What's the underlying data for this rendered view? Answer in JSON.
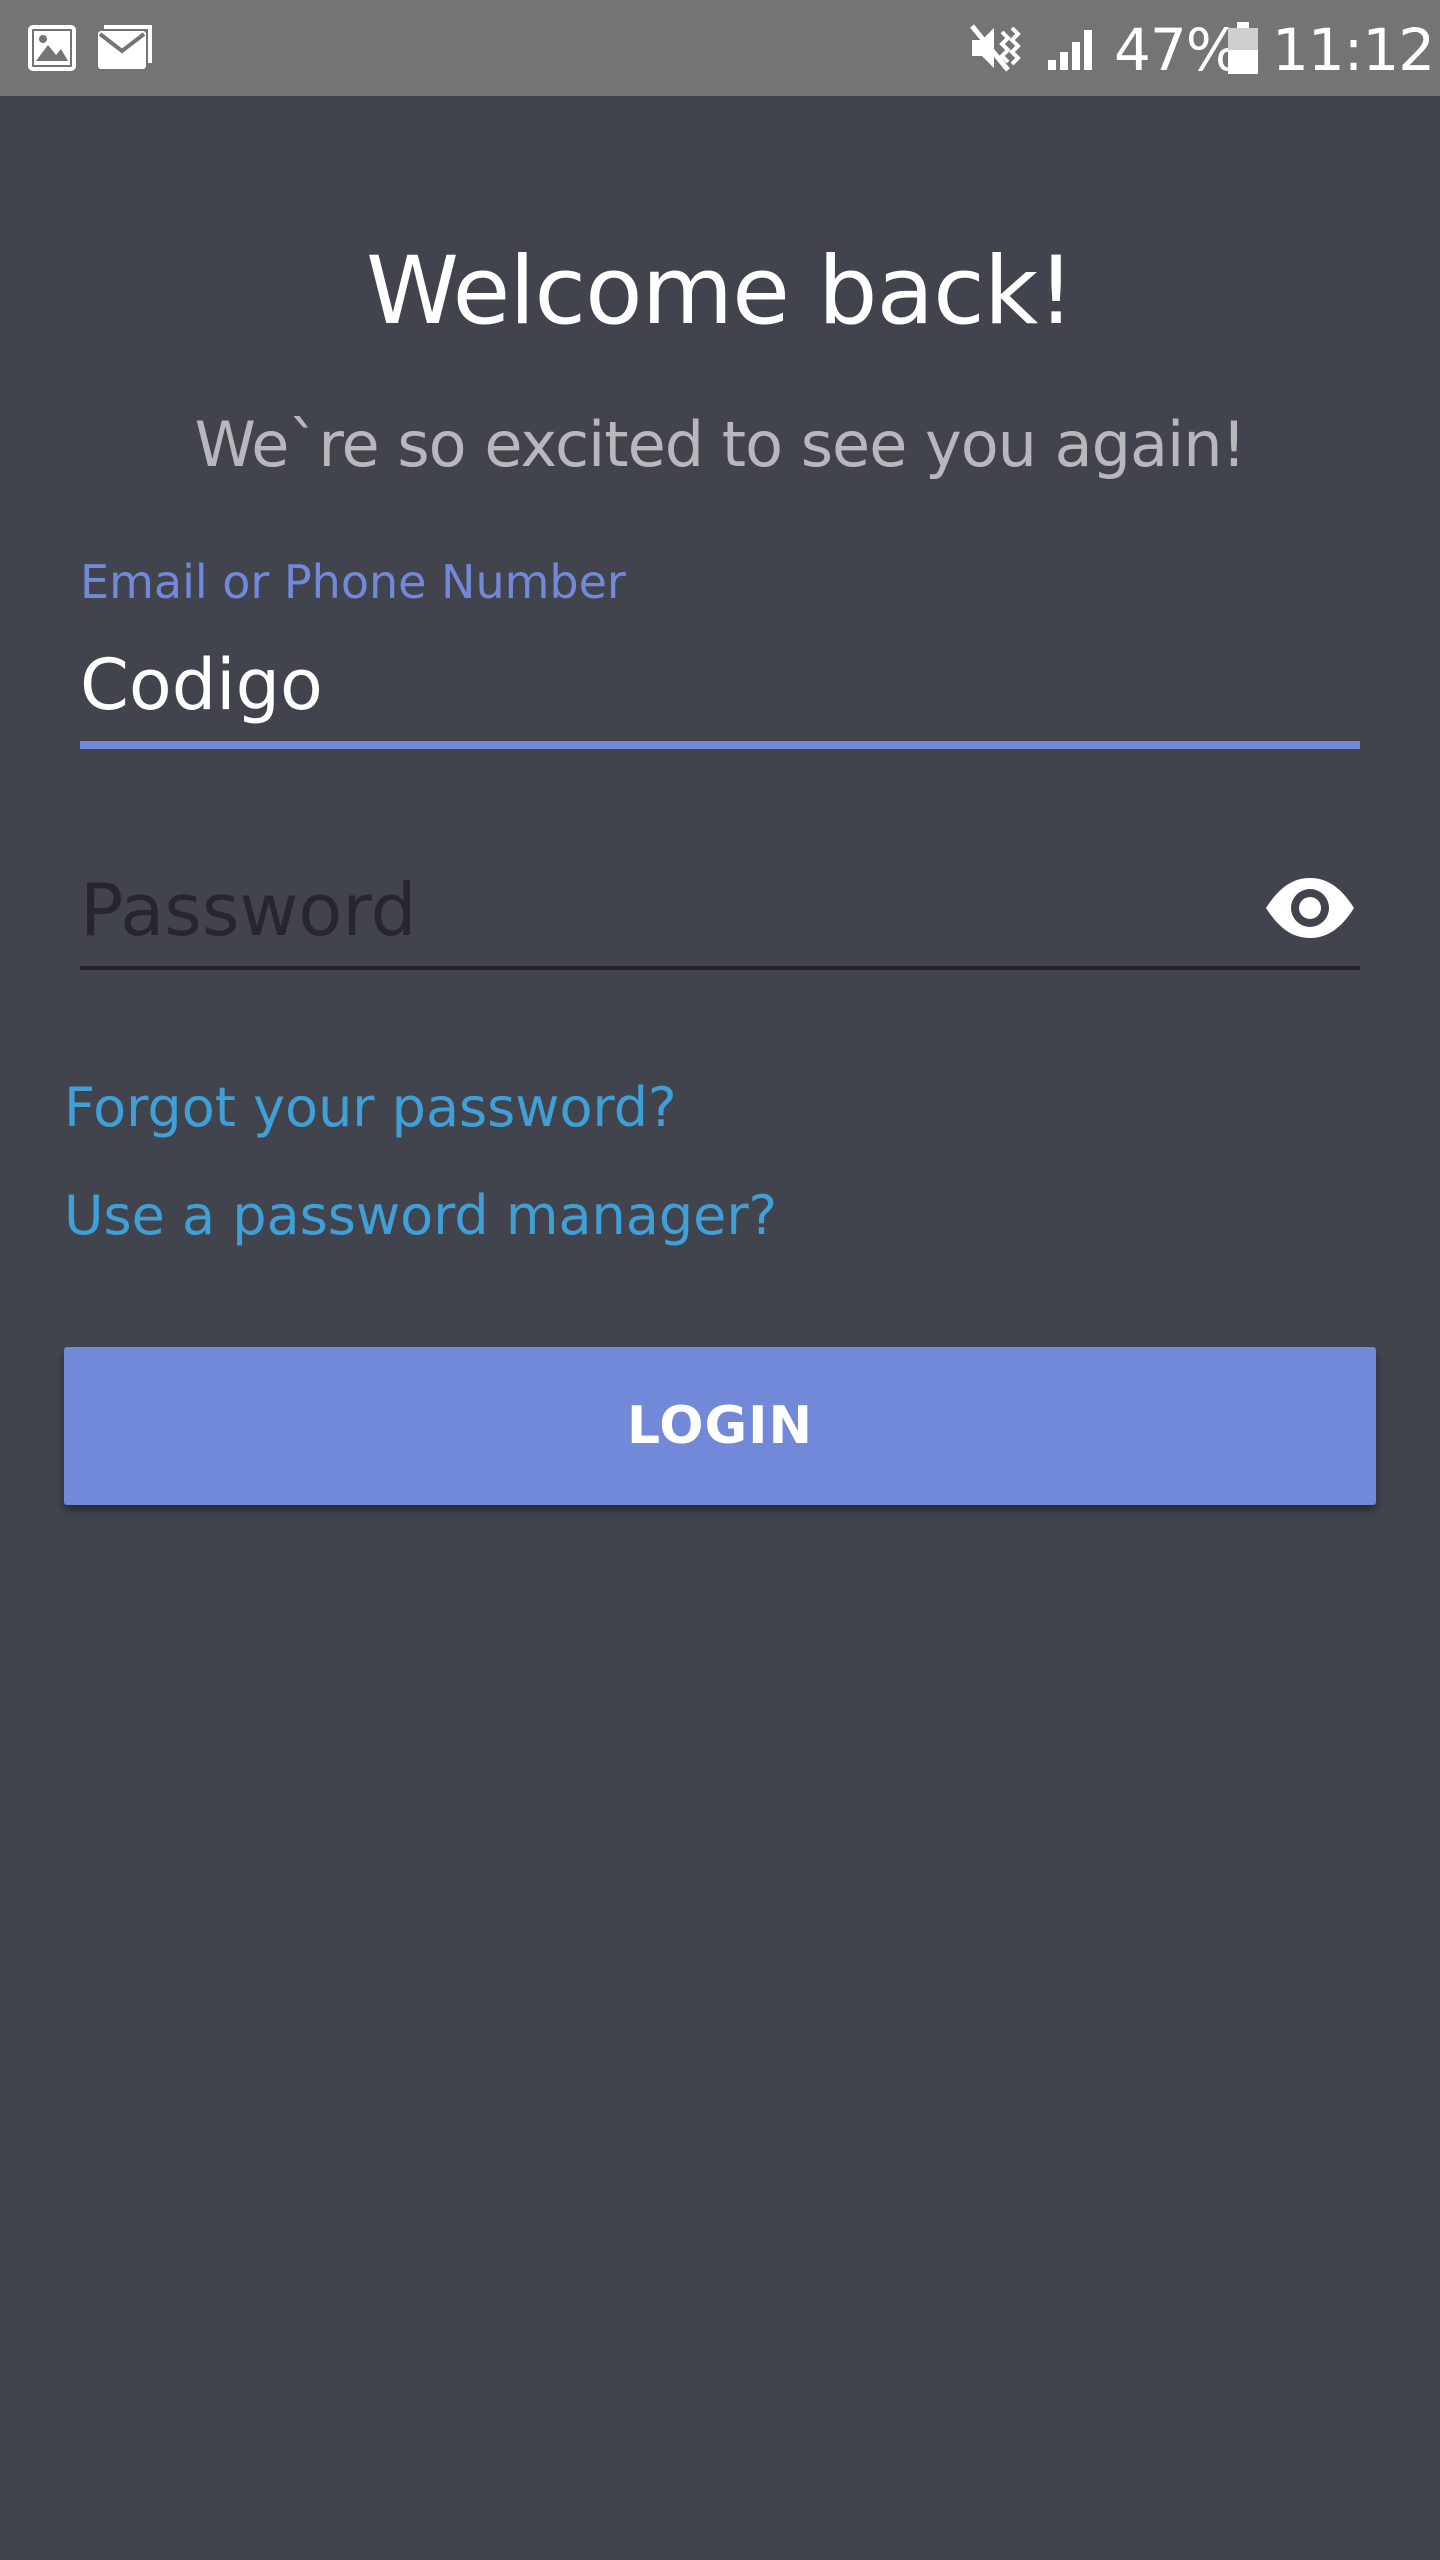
{
  "status_bar": {
    "left_icons": [
      "image-icon",
      "email-icon"
    ],
    "right_icons": [
      "vibrate-mute-icon",
      "signal-icon",
      "battery-icon"
    ],
    "battery_percent": "47%",
    "time": "11:12"
  },
  "login": {
    "title": "Welcome back!",
    "subtitle": "We`re so excited to see you again!",
    "email_label": "Email or Phone Number",
    "email_value": "Codigo",
    "password_placeholder": "Password",
    "password_toggle_icon": "eye-icon",
    "forgot_link": "Forgot your password?",
    "manager_link": "Use a password manager?",
    "login_button": "LOGIN"
  },
  "colors": {
    "background": "#41444d",
    "status_bar": "#747474",
    "accent": "#7289da",
    "link": "#3f9fd6",
    "subtitle": "#b7b8bc"
  }
}
